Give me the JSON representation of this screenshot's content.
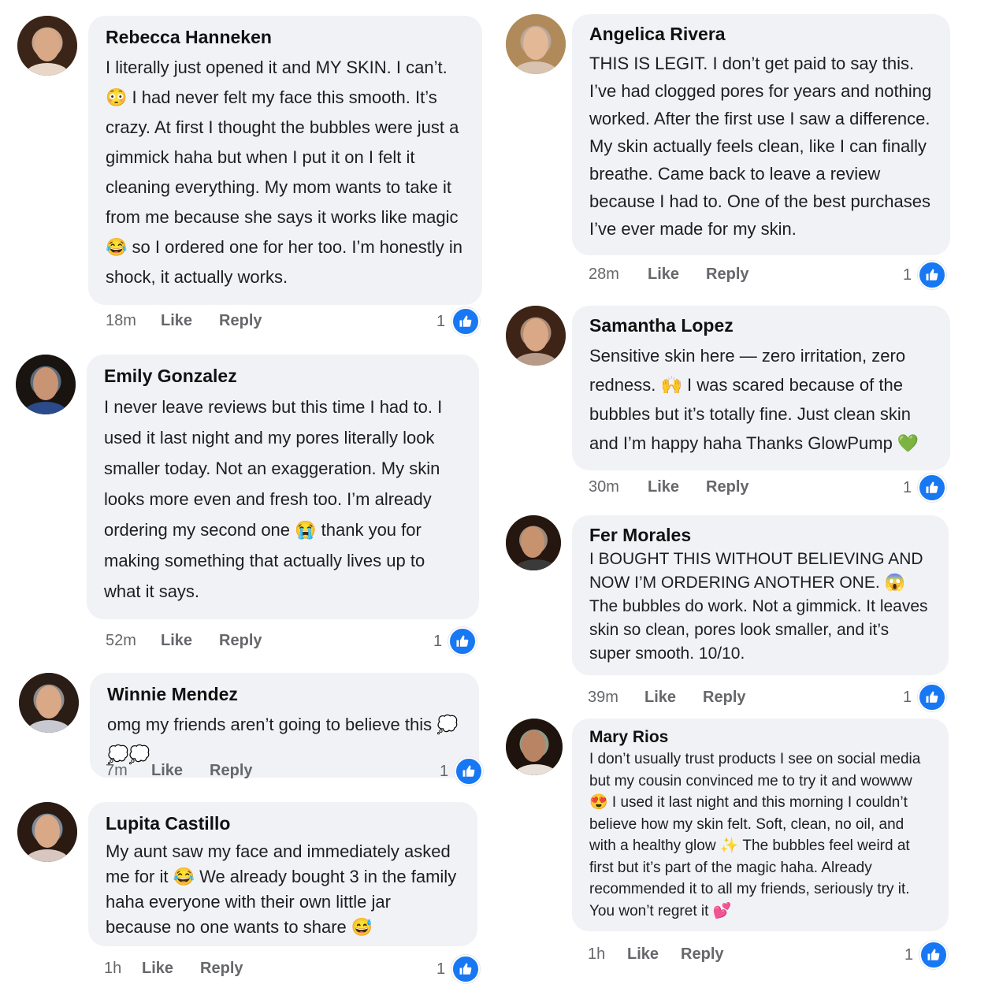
{
  "comments": [
    {
      "name": "Rebecca Hanneken",
      "text": "I literally just opened it and MY SKIN. I can’t. 😳 I had never felt my face this smooth. It’s crazy. At first I thought the bubbles were just a gimmick haha but when I put it on I felt it cleaning everything. My mom wants to take it from me because she says it works like magic 😂 so I ordered one for her too. I’m honestly in shock, it actually works.",
      "time": "18m",
      "like": "Like",
      "reply": "Reply",
      "likes": "1"
    },
    {
      "name": "Emily Gonzalez",
      "text": "I never leave reviews but this time I had to. I used it last night and my pores literally look smaller today. Not an exaggeration. My skin looks more even and fresh too. I’m already ordering my second one 😭 thank you for making something that actually lives up to what it says.",
      "time": "52m",
      "like": "Like",
      "reply": "Reply",
      "likes": "1"
    },
    {
      "name": "Winnie Mendez",
      "text": "omg my friends aren’t going to believe this 💭💭💭",
      "time": "7m",
      "like": "Like",
      "reply": "Reply",
      "likes": "1"
    },
    {
      "name": "Lupita Castillo",
      "text": "My aunt saw my face and immediately asked me for it 😂 We already bought 3 in the family haha everyone with their own little jar because no one wants to share 😅",
      "time": "1h",
      "like": "Like",
      "reply": "Reply",
      "likes": "1"
    },
    {
      "name": "Angelica Rivera",
      "text": "THIS IS LEGIT. I don’t get paid to say this. I’ve had clogged pores for years and nothing worked. After the first use I saw a difference. My skin actually feels clean, like I can finally breathe. Came back to leave a review because I had to. One of the best purchases I’ve ever made for my skin.",
      "time": "28m",
      "like": "Like",
      "reply": "Reply",
      "likes": "1"
    },
    {
      "name": "Samantha Lopez",
      "text": "Sensitive skin here — zero irritation, zero redness. 🙌 I was scared because of the bubbles but it’s totally fine. Just clean skin and I’m happy haha Thanks GlowPump 💚",
      "time": "30m",
      "like": "Like",
      "reply": "Reply",
      "likes": "1"
    },
    {
      "name": "Fer Morales",
      "text": "I BOUGHT THIS WITHOUT BELIEVING AND NOW I’M ORDERING ANOTHER ONE. 😱 The bubbles do work. Not a gimmick. It leaves skin so clean, pores look smaller, and it’s super smooth. 10/10.",
      "time": "39m",
      "like": "Like",
      "reply": "Reply",
      "likes": "1"
    },
    {
      "name": "Mary Rios",
      "text": "I don’t usually trust products I see on social media but my cousin convinced me to try it and wowww 😍 I used it last night and this morning I couldn’t believe how my skin felt. Soft, clean, no oil, and with a healthy glow ✨ The bubbles feel weird at first but it’s part of the magic haha. Already recommended it to all my friends, seriously try it. You won’t regret it 💕",
      "time": "1h",
      "like": "Like",
      "reply": "Reply",
      "likes": "1"
    }
  ],
  "colors": {
    "bubble": "#f0f2f5",
    "meta_text": "#65676b",
    "like_blue": "#1877f2"
  }
}
